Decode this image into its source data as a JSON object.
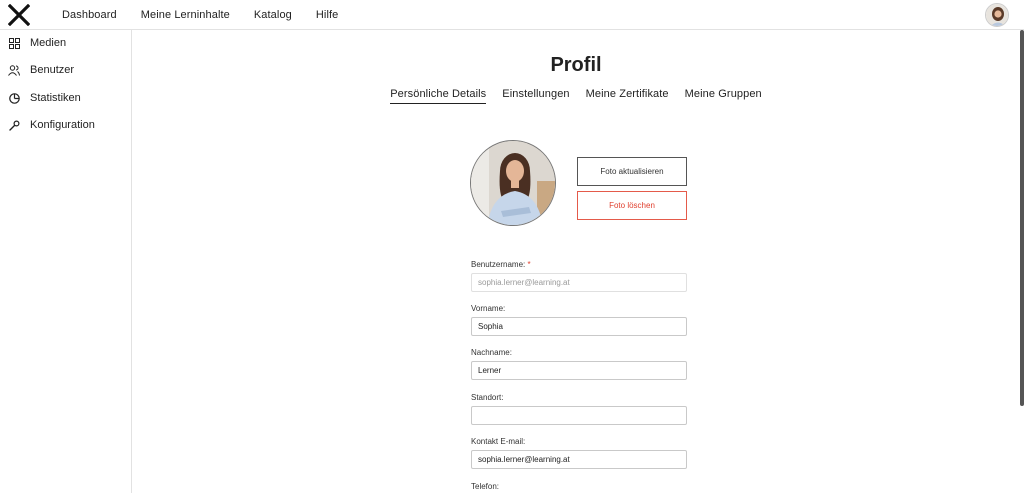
{
  "nav": {
    "items": [
      "Dashboard",
      "Meine Lerninhalte",
      "Katalog",
      "Hilfe"
    ]
  },
  "sidebar": {
    "items": [
      {
        "label": "Medien",
        "icon": "grid-icon"
      },
      {
        "label": "Benutzer",
        "icon": "users-icon"
      },
      {
        "label": "Statistiken",
        "icon": "pie-chart-icon"
      },
      {
        "label": "Konfiguration",
        "icon": "wrench-icon"
      }
    ]
  },
  "page": {
    "title": "Profil",
    "tabs": [
      "Persönliche Details",
      "Einstellungen",
      "Meine Zertifikate",
      "Meine Gruppen"
    ],
    "active_tab": "Persönliche Details"
  },
  "photo": {
    "update_label": "Foto aktualisieren",
    "delete_label": "Foto löschen"
  },
  "form": {
    "username": {
      "label": "Benutzername:",
      "required_mark": "*",
      "value": "sophia.lerner@learning.at"
    },
    "firstname": {
      "label": "Vorname:",
      "value": "Sophia"
    },
    "lastname": {
      "label": "Nachname:",
      "value": "Lerner"
    },
    "location": {
      "label": "Standort:",
      "value": ""
    },
    "email": {
      "label": "Kontakt E-mail:",
      "value": "sophia.lerner@learning.at"
    },
    "phone": {
      "label": "Telefon:"
    }
  },
  "colors": {
    "danger": "#e0402f",
    "border": "#c9c9c9",
    "text": "#222222"
  }
}
